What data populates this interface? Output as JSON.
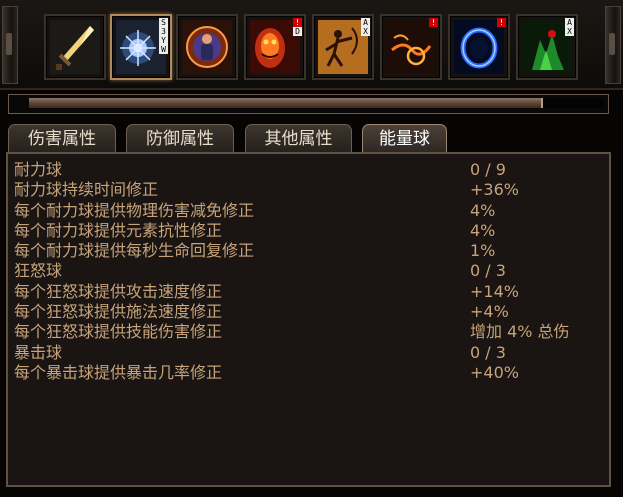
{
  "skill_bar": {
    "skills": [
      {
        "name": "sword-skill",
        "tags": []
      },
      {
        "name": "frost-energy-skill",
        "tags": [
          "S",
          "3",
          "Y",
          "W"
        ]
      },
      {
        "name": "warrior-aura-skill",
        "tags": []
      },
      {
        "name": "fire-demon-skill",
        "tags": [
          "!",
          "D"
        ]
      },
      {
        "name": "archer-skill",
        "tags": [
          "A",
          "X"
        ]
      },
      {
        "name": "fire-lasso-skill",
        "tags": [
          "!"
        ]
      },
      {
        "name": "blue-portal-skill",
        "tags": [
          "!"
        ]
      },
      {
        "name": "green-totem-skill",
        "tags": [
          "A",
          "X"
        ]
      }
    ]
  },
  "progress": {
    "fill_fraction": 0.89
  },
  "tabs": [
    {
      "label": "伤害属性",
      "active": false
    },
    {
      "label": "防御属性",
      "active": false
    },
    {
      "label": "其他属性",
      "active": false
    },
    {
      "label": "能量球",
      "active": true
    }
  ],
  "stats": [
    {
      "label": "耐力球",
      "value": "0 / 9"
    },
    {
      "label": "耐力球持续时间修正",
      "value": "+36%"
    },
    {
      "label": "每个耐力球提供物理伤害减免修正",
      "value": "4%"
    },
    {
      "label": "每个耐力球提供元素抗性修正",
      "value": "4%"
    },
    {
      "label": "每个耐力球提供每秒生命回复修正",
      "value": "1%"
    },
    {
      "label": "狂怒球",
      "value": "0 / 3"
    },
    {
      "label": "每个狂怒球提供攻击速度修正",
      "value": "+14%"
    },
    {
      "label": "每个狂怒球提供施法速度修正",
      "value": "+4%"
    },
    {
      "label": "每个狂怒球提供技能伤害修正",
      "value": "增加 4% 总伤"
    },
    {
      "label": "暴击球",
      "value": "0 / 3"
    },
    {
      "label": "每个暴击球提供暴击几率修正",
      "value": "+40%"
    }
  ]
}
